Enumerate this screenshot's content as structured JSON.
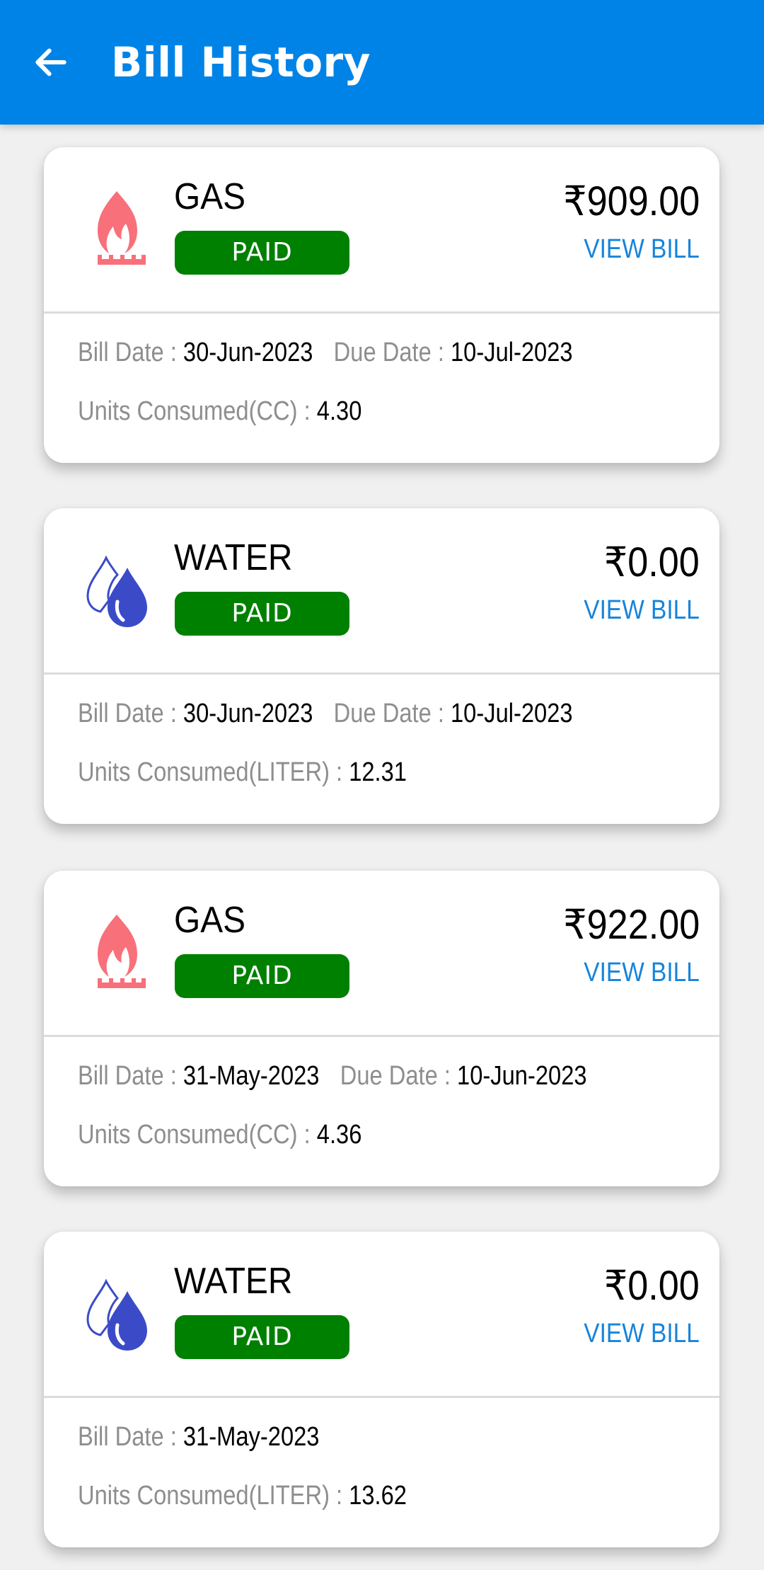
{
  "app_bar": {
    "title": "Bill History",
    "back_icon": "arrow-left-icon"
  },
  "colors": {
    "app_bar": "#0083E6",
    "paid_badge": "#008000",
    "view_bill_link": "#1684DB",
    "gas_icon": "#F8707A",
    "water_icon": "#3B4BC8",
    "label_gray": "#8E8E8E"
  },
  "labels": {
    "bill_date": "Bill Date : ",
    "due_date": "Due Date : ",
    "view_bill": "VIEW BILL"
  },
  "bills": [
    {
      "utility": "GAS",
      "icon": "gas-flame-icon",
      "status": "PAID",
      "amount": "₹909.00",
      "view_bill": "VIEW BILL",
      "bill_date": "30-Jun-2023",
      "due_date": "10-Jul-2023",
      "units_label": "Units Consumed(CC) : ",
      "units_value": "4.30"
    },
    {
      "utility": "WATER",
      "icon": "water-drops-icon",
      "status": "PAID",
      "amount": "₹0.00",
      "view_bill": "VIEW BILL",
      "bill_date": "30-Jun-2023",
      "due_date": "10-Jul-2023",
      "units_label": "Units Consumed(LITER) : ",
      "units_value": "12.31"
    },
    {
      "utility": "GAS",
      "icon": "gas-flame-icon",
      "status": "PAID",
      "amount": "₹922.00",
      "view_bill": "VIEW BILL",
      "bill_date": "31-May-2023",
      "due_date": "10-Jun-2023",
      "units_label": "Units Consumed(CC) : ",
      "units_value": "4.36"
    },
    {
      "utility": "WATER",
      "icon": "water-drops-icon",
      "status": "PAID",
      "amount": "₹0.00",
      "view_bill": "VIEW BILL",
      "bill_date": "31-May-2023",
      "due_date": null,
      "units_label": "Units Consumed(LITER) : ",
      "units_value": "13.62"
    }
  ]
}
